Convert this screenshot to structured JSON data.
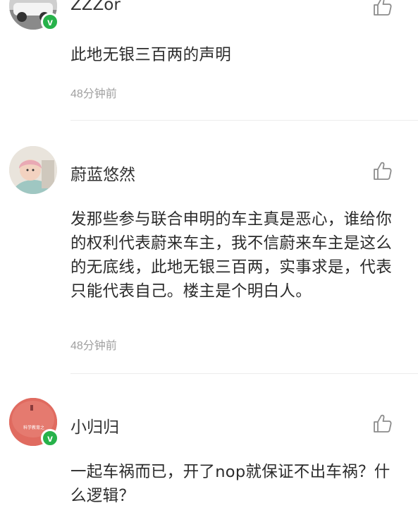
{
  "comments": [
    {
      "username": "ZZZor",
      "text": "此地无银三百两的声明",
      "time": "48分钟前",
      "verified_glyph": "v"
    },
    {
      "username": "蔚蓝悠然",
      "text": "发那些参与联合申明的车主真是恶心，谁给你的权利代表蔚来车主，我不信蔚来车主是这么的无底线，此地无银三百两，实事求是，代表只能代表自己。楼主是个明白人。",
      "time": "48分钟前"
    },
    {
      "username": "小归归",
      "text": "一起车祸而已，开了nop就保证不出车祸？什么逻辑？",
      "verified_glyph": "v",
      "avatar_text": "科学教育之"
    }
  ],
  "icons": {
    "like": "thumbs-up-icon",
    "verified": "verified-badge-icon"
  },
  "colors": {
    "verified_green": "#27b24a",
    "time_gray": "#a0a0a0",
    "divider": "#ececec"
  }
}
